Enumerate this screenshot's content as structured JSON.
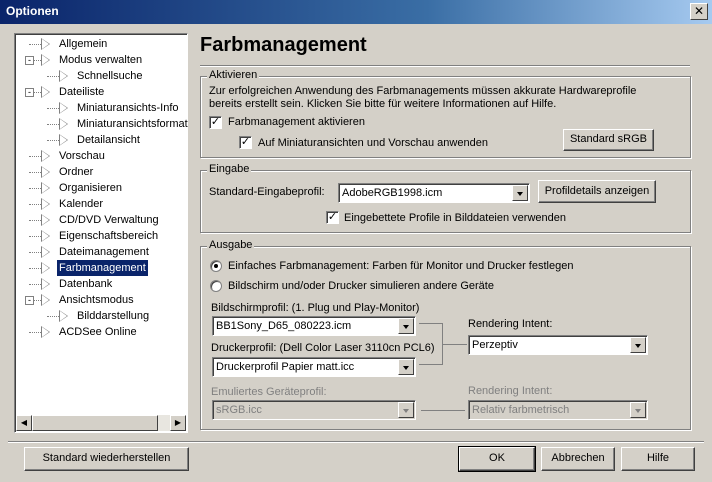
{
  "window": {
    "title": "Optionen",
    "close": "✕"
  },
  "tree": {
    "items": [
      {
        "label": "Allgemein"
      },
      {
        "label": "Modus verwalten"
      },
      {
        "label": "Schnellsuche"
      },
      {
        "label": "Dateiliste"
      },
      {
        "label": "Miniaturansichts-Info"
      },
      {
        "label": "Miniaturansichtsformat"
      },
      {
        "label": "Detailansicht"
      },
      {
        "label": "Vorschau"
      },
      {
        "label": "Ordner"
      },
      {
        "label": "Organisieren"
      },
      {
        "label": "Kalender"
      },
      {
        "label": "CD/DVD Verwaltung"
      },
      {
        "label": "Eigenschaftsbereich"
      },
      {
        "label": "Dateimanagement"
      },
      {
        "label": "Farbmanagement"
      },
      {
        "label": "Datenbank"
      },
      {
        "label": "Ansichtsmodus"
      },
      {
        "label": "Bilddarstellung"
      },
      {
        "label": "ACDSee Online"
      }
    ],
    "selected": "Farbmanagement"
  },
  "page_title": "Farbmanagement",
  "aktivieren": {
    "legend": "Aktivieren",
    "desc_line1": "Zur erfolgreichen Anwendung des Farbmanagements müssen akkurate Hardwareprofile",
    "desc_line2": "bereits erstellt sein. Klicken Sie bitte für weitere Informationen auf Hilfe.",
    "enable_label": "Farbmanagement aktivieren",
    "enable_checked": true,
    "thumbs_label": "Auf Miniaturansichten und Vorschau anwenden",
    "thumbs_checked": true,
    "standard_srgb": "Standard sRGB"
  },
  "eingabe": {
    "legend": "Eingabe",
    "profile_label": "Standard-Eingabeprofil:",
    "profile_value": "AdobeRGB1998.icm",
    "details_button": "Profildetails anzeigen",
    "embedded_label": "Eingebettete Profile in Bilddateien verwenden",
    "embedded_checked": true
  },
  "ausgabe": {
    "legend": "Ausgabe",
    "radio_simple": "Einfaches Farbmanagement: Farben für Monitor und Drucker festlegen",
    "radio_simulate": "Bildschirm und/oder Drucker simulieren andere Geräte",
    "selected_radio": "simple",
    "screen_label": "Bildschirmprofil: (1. Plug und Play-Monitor)",
    "screen_value": "BB1Sony_D65_080223.icm",
    "printer_label": "Druckerprofil: (Dell Color Laser 3110cn PCL6)",
    "printer_value": "Druckerprofil Papier matt.icc",
    "intent_label": "Rendering Intent:",
    "intent_value": "Perzeptiv",
    "emulated_label": "Emuliertes Geräteprofil:",
    "emulated_value": "sRGB.icc",
    "intent2_label": "Rendering Intent:",
    "intent2_value": "Relativ farbmetrisch"
  },
  "footer": {
    "restore": "Standard wiederherstellen",
    "ok": "OK",
    "cancel": "Abbrechen",
    "help": "Hilfe"
  }
}
